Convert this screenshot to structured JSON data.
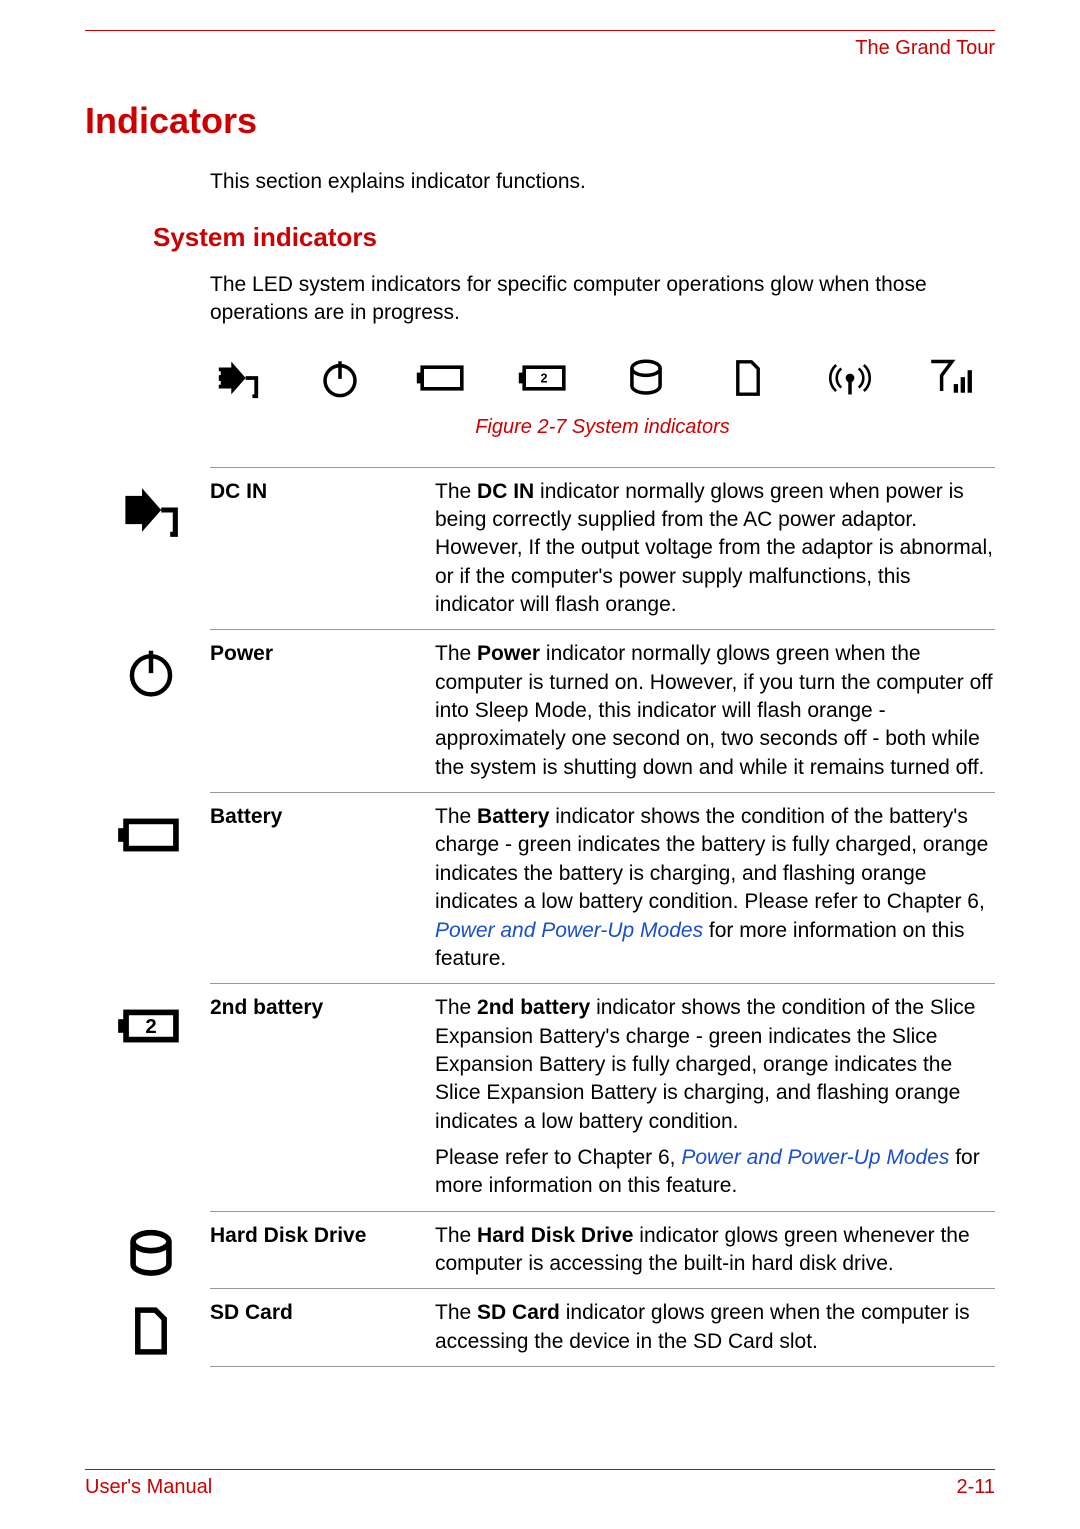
{
  "header": {
    "section": "The Grand Tour"
  },
  "headings": {
    "main": "Indicators",
    "sub": "System indicators"
  },
  "intro": "This section explains indicator functions.",
  "sub_intro": "The LED system indicators for specific computer operations glow when those operations are in progress.",
  "figure_caption": "Figure 2-7 System indicators",
  "rows": {
    "dc_in": {
      "label": "DC IN",
      "bold": "DC IN",
      "desc_pre": "The ",
      "desc_post": " indicator normally glows green when power is being correctly supplied from the AC power adaptor. However, If the output voltage from the adaptor is abnormal, or if the computer's power supply malfunctions, this indicator will flash orange."
    },
    "power": {
      "label": "Power",
      "bold": "Power",
      "desc_pre": "The ",
      "desc_post": " indicator normally glows green when the computer is turned on. However, if you turn the computer off into Sleep Mode, this indicator will flash orange - approximately one second on, two seconds off - both while the system is shutting down and while it remains turned off."
    },
    "battery": {
      "label": "Battery",
      "bold": "Battery",
      "desc_pre": "The ",
      "desc_mid": " indicator shows the condition of the battery's charge - green indicates the battery is fully charged, orange indicates the battery is charging, and flashing orange indicates a low battery condition. Please refer to Chapter 6, ",
      "link": "Power and Power-Up Modes",
      "desc_post": " for more information on this feature."
    },
    "second_battery": {
      "label": "2nd battery",
      "bold": "2nd battery",
      "p1_pre": "The ",
      "p1_post": " indicator shows the condition of the Slice Expansion Battery's charge - green indicates the Slice Expansion Battery is fully charged, orange indicates the Slice Expansion Battery is charging, and flashing orange indicates a low battery condition.",
      "p2_pre": "Please refer to Chapter 6, ",
      "link": "Power and Power-Up Modes",
      "p2_post": " for more information on this feature."
    },
    "hdd": {
      "label": "Hard Disk Drive",
      "bold": "Hard Disk Drive",
      "desc_pre": "The ",
      "desc_post": " indicator glows green whenever the computer is accessing the built-in hard disk drive."
    },
    "sd": {
      "label": "SD Card",
      "bold": "SD Card",
      "desc_pre": "The ",
      "desc_post": " indicator glows green when the computer is accessing the device in the SD Card slot."
    }
  },
  "footer": {
    "left": "User's Manual",
    "right": "2-11"
  },
  "icon_row": {
    "battery2_number": "2"
  }
}
